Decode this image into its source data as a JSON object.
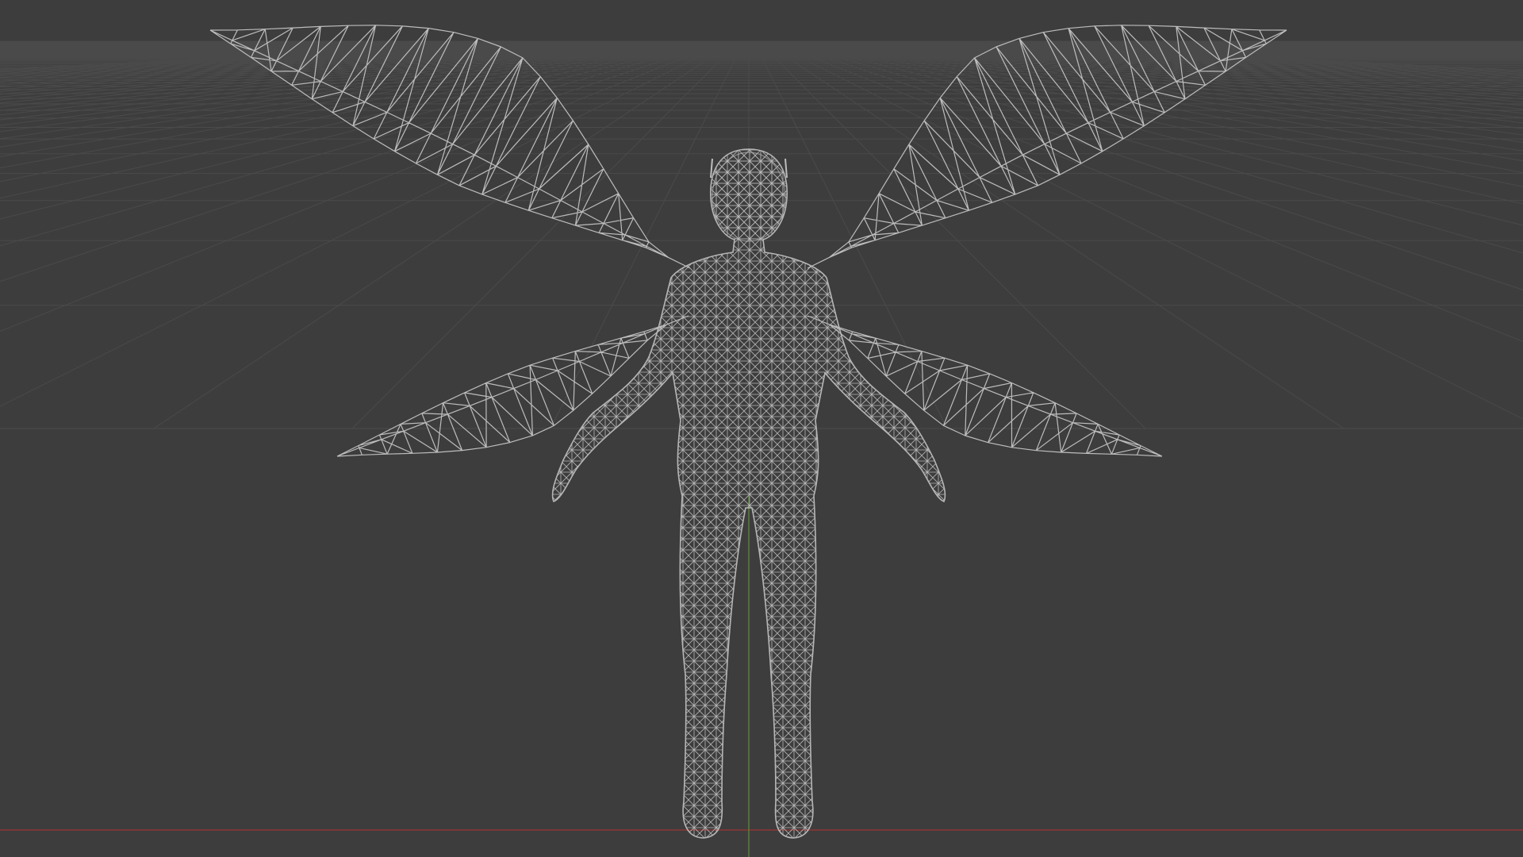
{
  "viewport": {
    "mode": "wireframe",
    "view": "front",
    "object": "winged-figure-mesh",
    "colors": {
      "background": "#3d3d3d",
      "grid": "#4b4b4b",
      "wire": "#bdbdbd",
      "x_axis": "#9b3434",
      "z_axis": "#5f8a32"
    }
  }
}
